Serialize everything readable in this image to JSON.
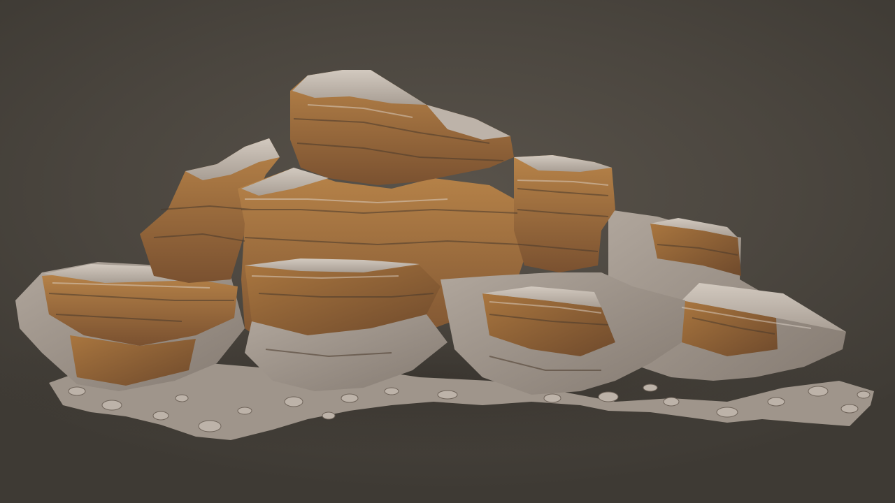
{
  "scene": {
    "subject": "rock-formation-3d-render",
    "palette": {
      "background": "#4b463f",
      "background_light": "#59534b",
      "rock_ochre": "#a9763f",
      "rock_ochre_dark": "#7e5430",
      "rock_top": "#b5aca2",
      "rock_top_light": "#cfc6bc",
      "rock_shadow": "#4a3a2c",
      "rubble": "#a49a90"
    }
  }
}
